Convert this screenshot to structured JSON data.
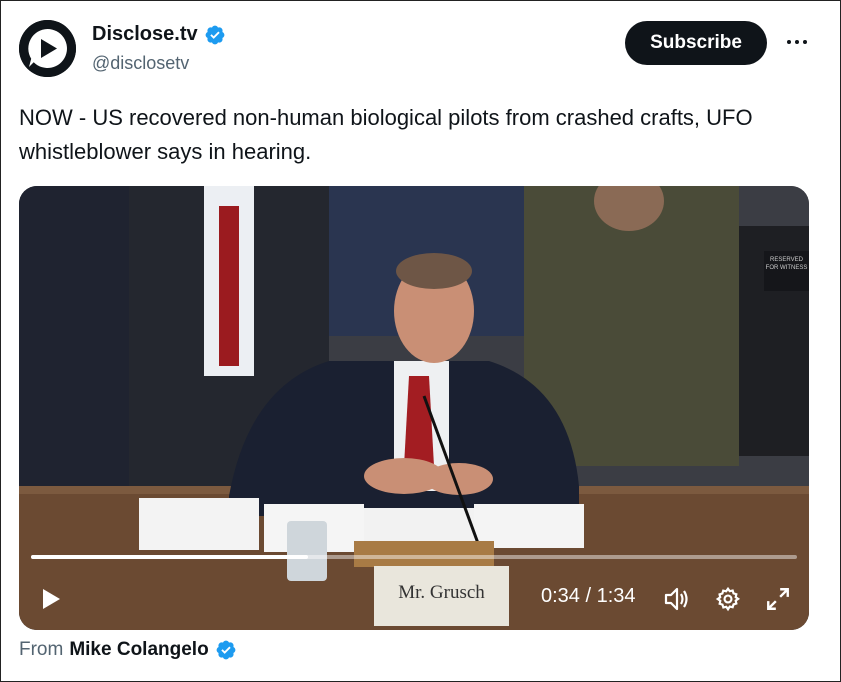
{
  "author": {
    "display_name": "Disclose.tv",
    "handle": "@disclosetv"
  },
  "actions": {
    "subscribe_label": "Subscribe"
  },
  "tweet": {
    "text": "NOW - US recovered non-human biological pilots from crashed crafts, UFO whistleblower says in hearing."
  },
  "video": {
    "current_time": "0:34",
    "separator": "/",
    "duration": "1:34",
    "progress": 0.362,
    "nameplate": "Mr. Grusch",
    "sign_text": "RESERVED FOR WITNESS"
  },
  "attribution": {
    "prefix": "From",
    "name": "Mike Colangelo"
  },
  "icons": {
    "avatar": "disclose-logo-icon",
    "verified": "verified-badge-icon",
    "more": "more-dots-icon",
    "play": "play-icon",
    "volume": "volume-icon",
    "settings": "gear-icon",
    "fullscreen": "expand-icon"
  },
  "colors": {
    "accent": "#1d9bf0",
    "text": "#0f1419",
    "muted": "#536471"
  }
}
